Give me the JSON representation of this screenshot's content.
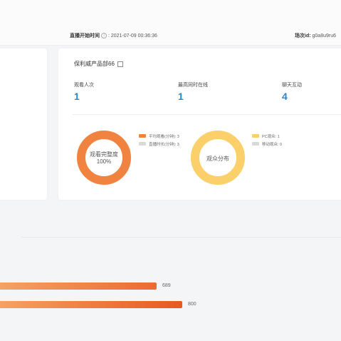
{
  "header": {
    "start_time_label": "直播开始时间",
    "start_time_value": ": 2021-07-09 00:36:36",
    "session_id_label": "场次id:",
    "session_id_value": "g0a8u9ru6"
  },
  "room": {
    "title": "保利威产品部66"
  },
  "stats": [
    {
      "label": "观看人次",
      "value": "1"
    },
    {
      "label": "最高同时在线",
      "value": "1"
    },
    {
      "label": "聊天互动",
      "value": "4"
    }
  ],
  "donut_completion": {
    "center_line1": "观看完整度",
    "center_line2": "100%",
    "color": "#f08340",
    "legend": [
      {
        "label": "平均观看(分钟): 3",
        "color": "#f08340"
      },
      {
        "label": "直播时长(分钟): 3",
        "color": "#d9d9d9"
      }
    ]
  },
  "donut_audience": {
    "center_text": "观众分布",
    "color": "#fbcf6a",
    "legend": [
      {
        "label": "PC观众: 1",
        "color": "#fbcf6a"
      },
      {
        "label": "移动观众: 0",
        "color": "#d9d9d9"
      }
    ]
  },
  "bars": [
    {
      "value": "689",
      "fraction": 0.861,
      "color_from": "#f5a263",
      "color_to": "#ee6a2f"
    },
    {
      "value": "800",
      "fraction": 1.0,
      "color_from": "#f5a263",
      "color_to": "#e8581f"
    }
  ]
}
